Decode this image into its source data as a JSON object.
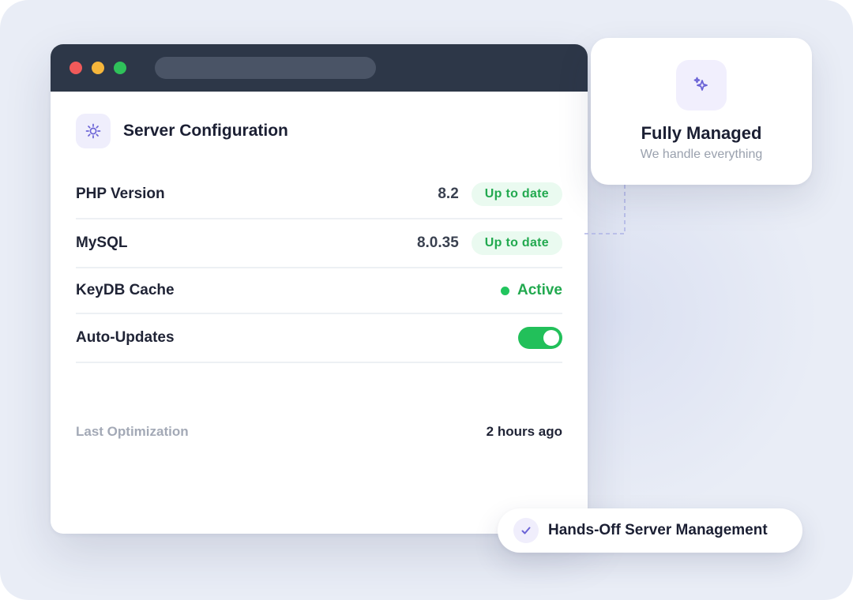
{
  "colors": {
    "accent": "#6b63d6",
    "success": "#22c55e",
    "titlebar": "#2d3748"
  },
  "window": {
    "controls": [
      "close",
      "minimize",
      "maximize"
    ]
  },
  "config_panel": {
    "icon": "gear-icon",
    "title": "Server Configuration",
    "rows": [
      {
        "label": "PHP Version",
        "value": "8.2",
        "badge": "Up to date"
      },
      {
        "label": "MySQL",
        "value": "8.0.35",
        "badge": "Up to date"
      },
      {
        "label": "KeyDB Cache",
        "status": "Active"
      },
      {
        "label": "Auto-Updates",
        "toggle_on": true
      }
    ],
    "footer": {
      "label": "Last Optimization",
      "value": "2 hours ago"
    }
  },
  "managed_card": {
    "icon": "sparkle-icon",
    "title": "Fully Managed",
    "subtitle": "We handle everything"
  },
  "badge": {
    "icon": "check-icon",
    "text": "Hands-Off Server Management"
  }
}
